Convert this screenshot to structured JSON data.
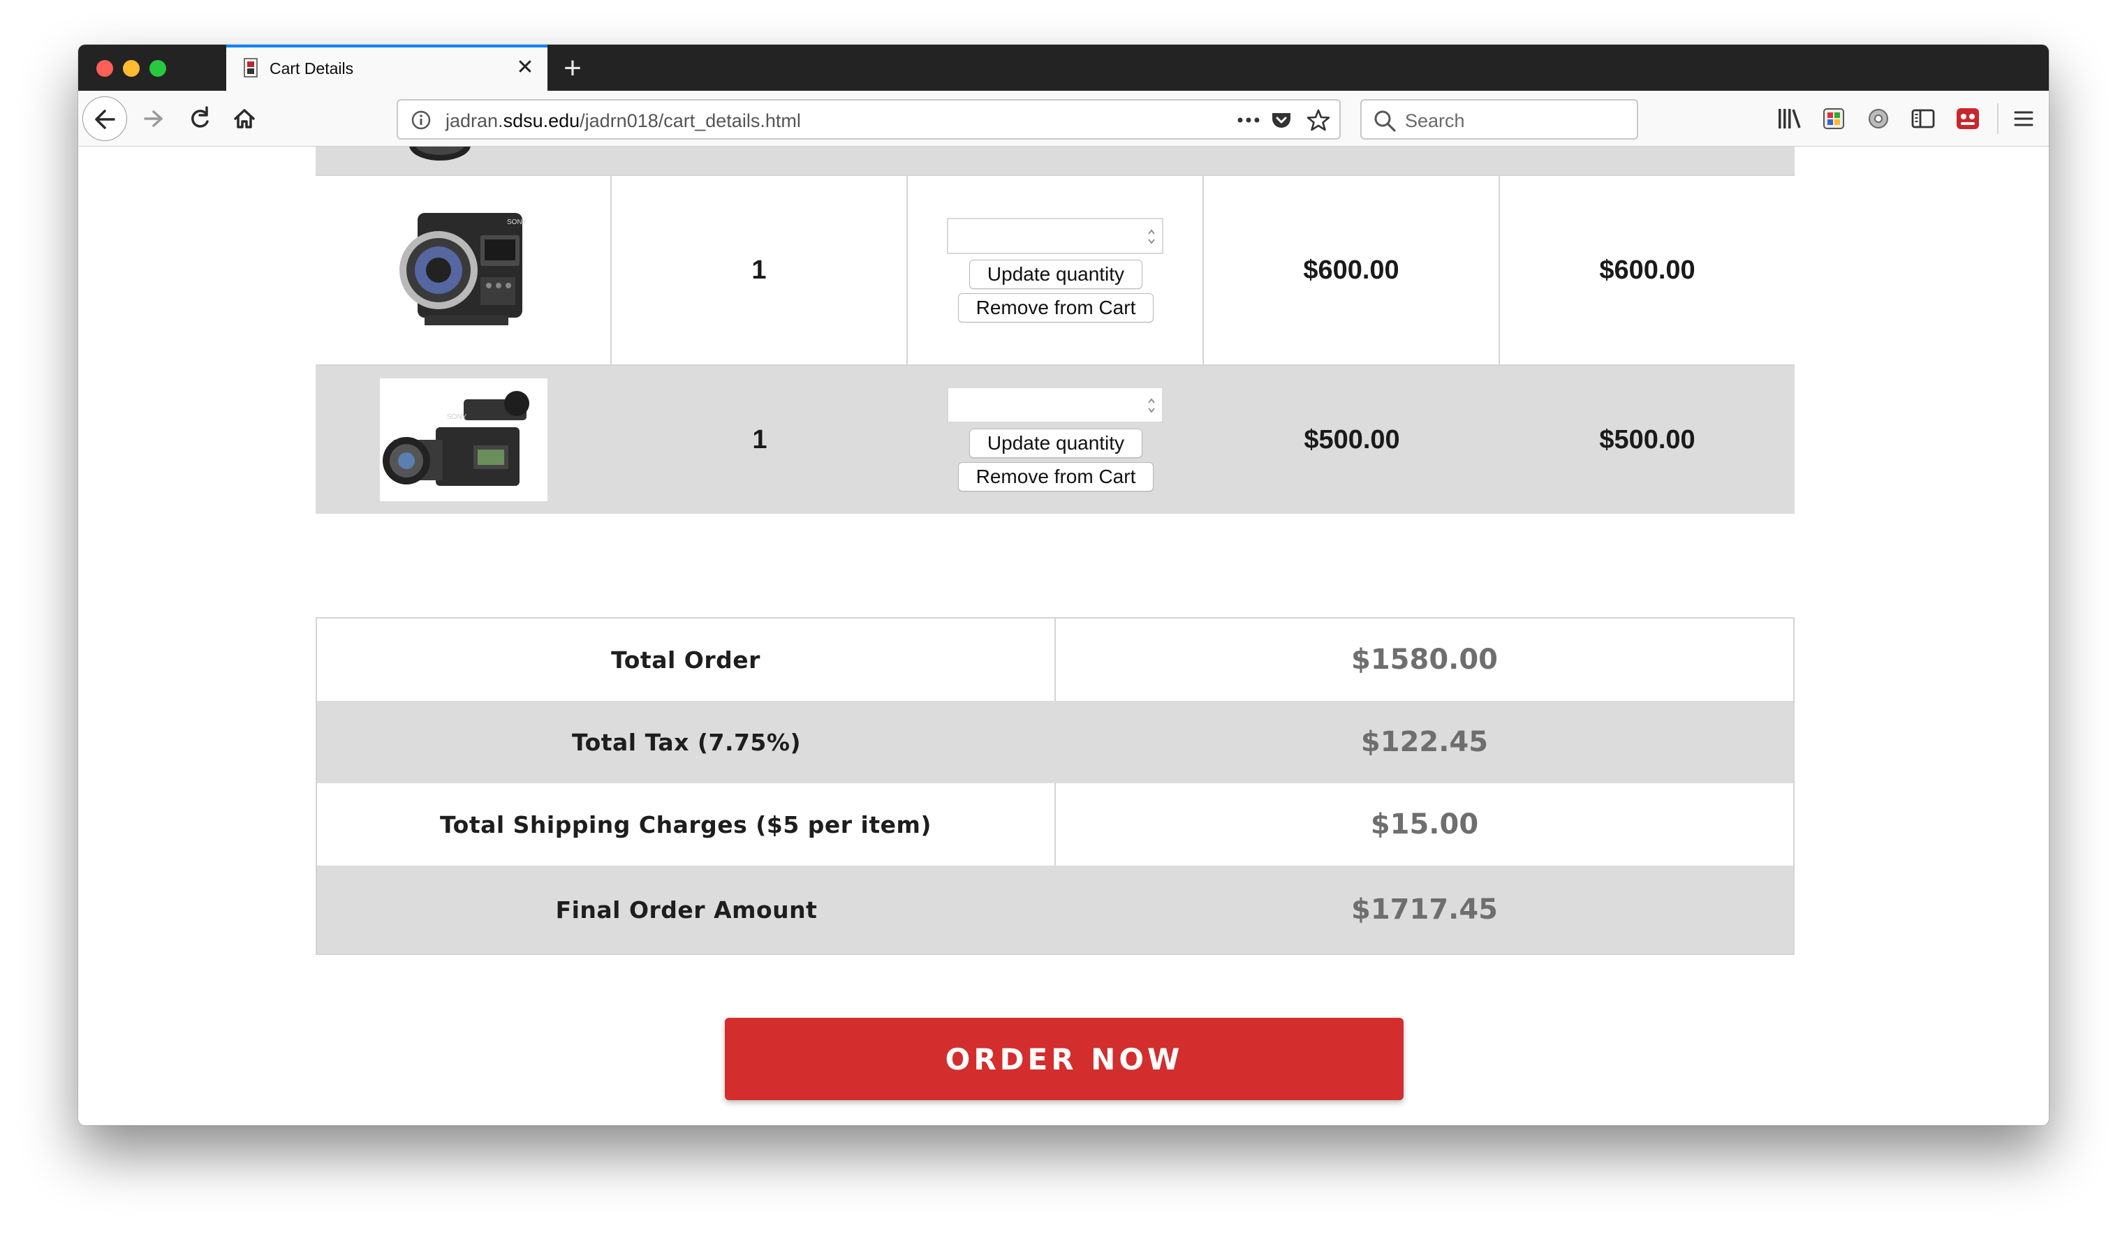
{
  "browser": {
    "tab_title": "Cart Details",
    "url_prefix": "jadran.",
    "url_domain": "sdsu.edu",
    "url_path": "/jadrn018/cart_details.html",
    "search_placeholder": "Search"
  },
  "colors": {
    "accent": "#d32d2d",
    "row_alt": "#dcdcdc",
    "tab_accent": "#0a84ff"
  },
  "cart": {
    "items": [
      {
        "image": "sony-cinema-camera-body",
        "quantity": "1",
        "update_label": "Update quantity",
        "remove_label": "Remove from Cart",
        "unit_price": "$600.00",
        "line_total": "$600.00"
      },
      {
        "image": "sony-camcorder-with-lens",
        "quantity": "1",
        "update_label": "Update quantity",
        "remove_label": "Remove from Cart",
        "unit_price": "$500.00",
        "line_total": "$500.00"
      }
    ]
  },
  "summary": {
    "rows": [
      {
        "label": "Total Order",
        "value": "$1580.00"
      },
      {
        "label": "Total Tax (7.75%)",
        "value": "$122.45"
      },
      {
        "label": "Total Shipping Charges ($5 per item)",
        "value": "$15.00"
      },
      {
        "label": "Final Order Amount",
        "value": "$1717.45"
      }
    ]
  },
  "order_button": "ORDER NOW"
}
